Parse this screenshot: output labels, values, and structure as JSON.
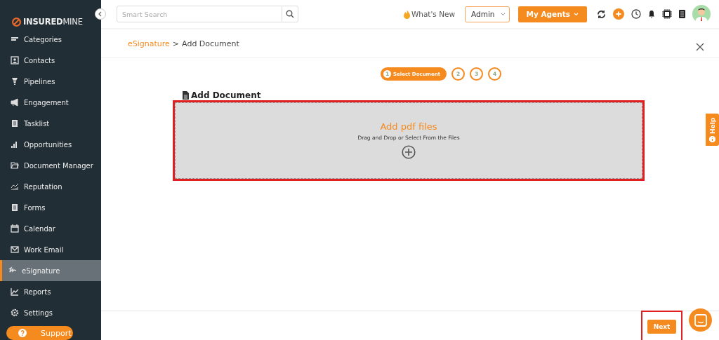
{
  "sidebar": {
    "logo": {
      "bold": "INSURED",
      "light": "MINE"
    },
    "items": [
      {
        "label": "Categories",
        "selected": false
      },
      {
        "label": "Contacts",
        "selected": false
      },
      {
        "label": "Pipelines",
        "selected": false
      },
      {
        "label": "Engagement",
        "selected": false
      },
      {
        "label": "Tasklist",
        "selected": false
      },
      {
        "label": "Opportunities",
        "selected": false
      },
      {
        "label": "Document Manager",
        "selected": false
      },
      {
        "label": "Reputation",
        "selected": false
      },
      {
        "label": "Forms",
        "selected": false
      },
      {
        "label": "Calendar",
        "selected": false
      },
      {
        "label": "Work Email",
        "selected": false
      },
      {
        "label": "eSignature",
        "selected": true
      },
      {
        "label": "Reports",
        "selected": false
      },
      {
        "label": "Settings",
        "selected": false
      }
    ],
    "support": "Support"
  },
  "topbar": {
    "search": {
      "placeholder": "Smart Search"
    },
    "whats_new": "What's New",
    "role": "Admin",
    "agents": "My Agents"
  },
  "breadcrumb": {
    "parent": "eSignature",
    "separator": ">",
    "current": "Add Document"
  },
  "steps": [
    {
      "number": "1",
      "label": "Select Document",
      "selected": true
    },
    {
      "number": "2",
      "selected": false
    },
    {
      "number": "3",
      "selected": false
    },
    {
      "number": "4",
      "selected": false
    }
  ],
  "section_title": "Add Document",
  "dropzone": {
    "title": "Add pdf files",
    "hint": "Drag and Drop or Select From the Files",
    "highlighted": true
  },
  "help_tab": "Help",
  "footer": {
    "next": "Next",
    "highlighted": true
  }
}
